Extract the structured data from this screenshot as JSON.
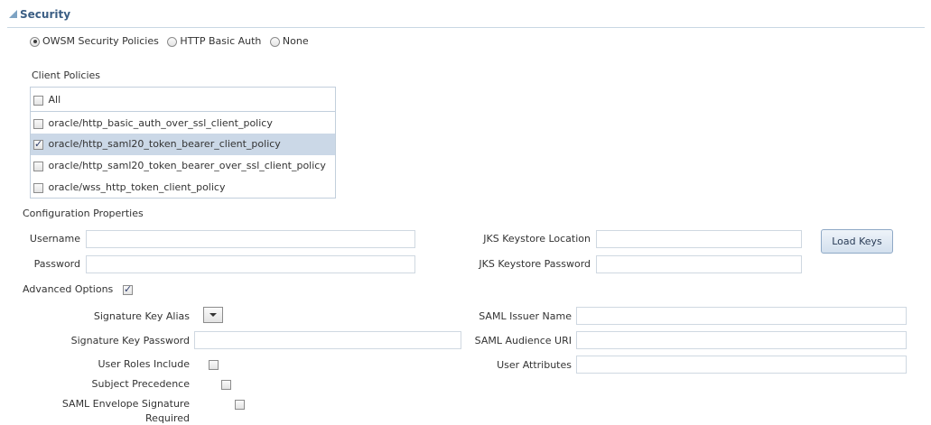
{
  "section": {
    "title": "Security"
  },
  "auth_options": [
    {
      "label": "OWSM Security Policies",
      "selected": true
    },
    {
      "label": "HTTP Basic Auth",
      "selected": false
    },
    {
      "label": "None",
      "selected": false
    }
  ],
  "client_policies": {
    "heading": "Client Policies",
    "all_label": "All",
    "items": [
      {
        "label": "oracle/http_basic_auth_over_ssl_client_policy",
        "checked": false
      },
      {
        "label": "oracle/http_saml20_token_bearer_client_policy",
        "checked": true
      },
      {
        "label": "oracle/http_saml20_token_bearer_over_ssl_client_policy",
        "checked": false
      },
      {
        "label": "oracle/wss_http_token_client_policy",
        "checked": false
      }
    ]
  },
  "config": {
    "heading": "Configuration Properties",
    "username_label": "Username",
    "username_value": "",
    "password_label": "Password",
    "password_value": "",
    "jks_location_label": "JKS Keystore Location",
    "jks_location_value": "",
    "jks_password_label": "JKS Keystore Password",
    "jks_password_value": "",
    "load_keys_label": "Load Keys"
  },
  "advanced": {
    "label": "Advanced Options",
    "checked": true,
    "signature_key_alias_label": "Signature Key Alias",
    "signature_key_password_label": "Signature Key Password",
    "user_roles_include_label": "User Roles Include",
    "subject_precedence_label": "Subject Precedence",
    "saml_envelope_label_line1": "SAML Envelope Signature",
    "saml_envelope_label_line2": "Required",
    "saml_issuer_label": "SAML Issuer Name",
    "saml_audience_label": "SAML Audience URI",
    "user_attributes_label": "User Attributes"
  },
  "colors": {
    "section_title": "#3b5e84",
    "selected_row": "#cbd8e7",
    "border": "#c2cfdc"
  }
}
